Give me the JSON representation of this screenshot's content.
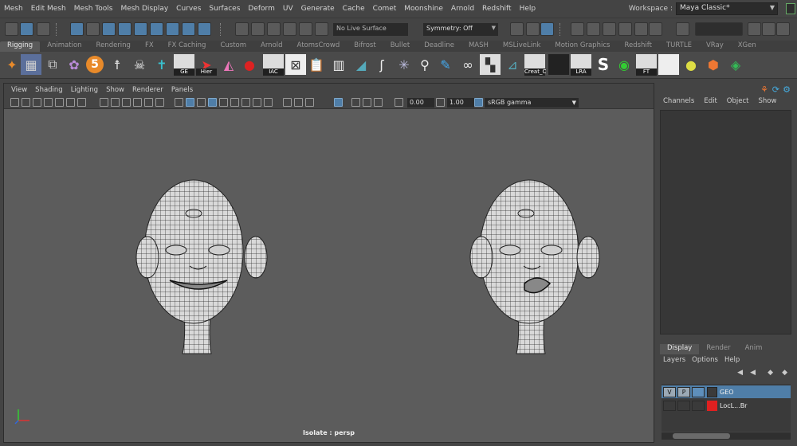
{
  "menubar": {
    "items": [
      "Mesh",
      "Edit Mesh",
      "Mesh Tools",
      "Mesh Display",
      "Curves",
      "Surfaces",
      "Deform",
      "UV",
      "Generate",
      "Cache",
      "Comet",
      "Moonshine",
      "Arnold",
      "Redshift",
      "Help"
    ]
  },
  "workspace": {
    "label": "Workspace :",
    "value": "Maya Classic*"
  },
  "statusline": {
    "live_surface": "No Live Surface",
    "symmetry": "Symmetry: Off"
  },
  "shelf_tabs": {
    "tabs": [
      "Rigging",
      "Animation",
      "Rendering",
      "FX",
      "FX Caching",
      "Custom",
      "Arnold",
      "AtomsCrowd",
      "Bifrost",
      "Bullet",
      "Deadline",
      "MASH",
      "MSLiveLink",
      "Motion Graphics",
      "Redshift",
      "TURTLE",
      "VRay",
      "XGen"
    ],
    "active": "Rigging"
  },
  "shelf": {
    "captions": {
      "ge": "GE",
      "hier": "Hier",
      "iac": "IAC",
      "creat": "Creat_C",
      "lra": "LRA",
      "ft": "FT",
      "s_glyph": "S",
      "five": "5"
    }
  },
  "viewport": {
    "panel_menu": [
      "View",
      "Shading",
      "Lighting",
      "Show",
      "Renderer",
      "Panels"
    ],
    "exposure": "0.00",
    "gamma_value": "1.00",
    "color_space": "sRGB gamma",
    "camera_label": "Isolate : persp"
  },
  "channel_box": {
    "menu": [
      "Channels",
      "Edit",
      "Object",
      "Show"
    ]
  },
  "layer_editor": {
    "tabs": [
      "Display",
      "Render",
      "Anim"
    ],
    "active_tab": "Display",
    "menu": [
      "Layers",
      "Options",
      "Help"
    ],
    "layers": [
      {
        "v": "V",
        "p": "P",
        "name": "GEO",
        "color": "#3b3b3b",
        "selected": true
      },
      {
        "v": "",
        "p": "",
        "name": "LocL...Br",
        "color": "#e02020",
        "selected": false
      }
    ]
  },
  "colors": {
    "accent": "#4f7ea8",
    "viewport_bg": "#5c5c5c",
    "panel_bg": "#444444"
  }
}
